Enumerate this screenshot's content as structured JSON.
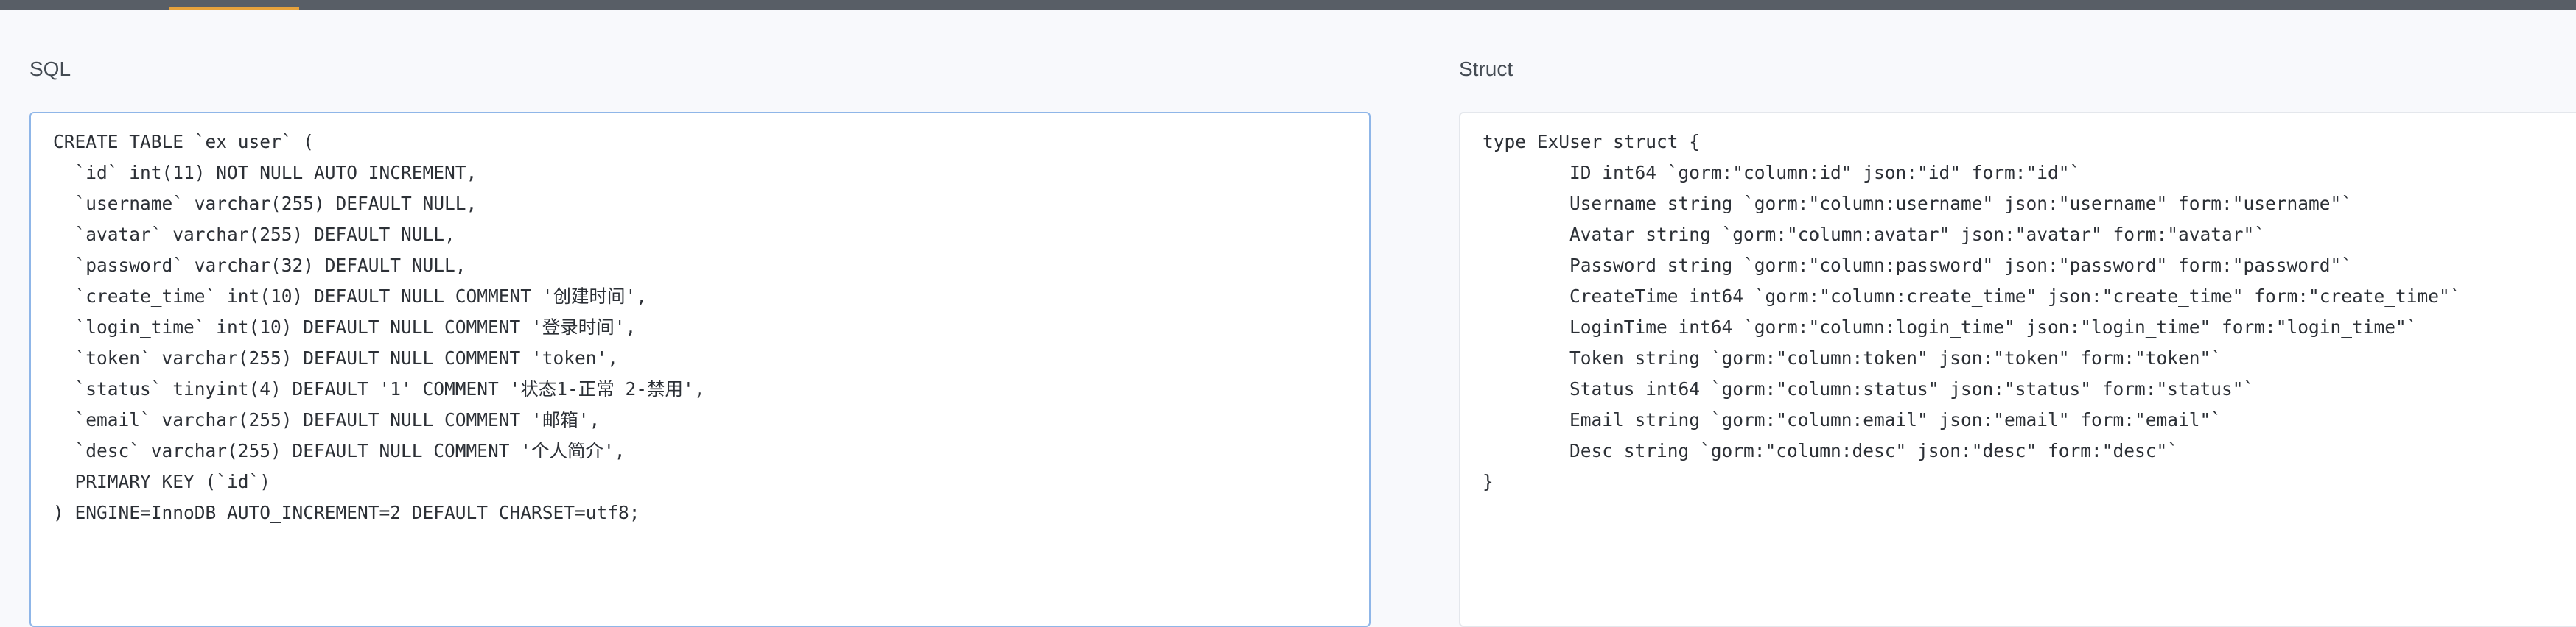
{
  "sql_panel": {
    "label": "SQL",
    "lines": [
      "CREATE TABLE `ex_user` (",
      "  `id` int(11) NOT NULL AUTO_INCREMENT,",
      "  `username` varchar(255) DEFAULT NULL,",
      "  `avatar` varchar(255) DEFAULT NULL,",
      "  `password` varchar(32) DEFAULT NULL,",
      "  `create_time` int(10) DEFAULT NULL COMMENT '创建时间',",
      "  `login_time` int(10) DEFAULT NULL COMMENT '登录时间',",
      "  `token` varchar(255) DEFAULT NULL COMMENT 'token',",
      "  `status` tinyint(4) DEFAULT '1' COMMENT '状态1-正常 2-禁用',",
      "  `email` varchar(255) DEFAULT NULL COMMENT '邮箱',",
      "  `desc` varchar(255) DEFAULT NULL COMMENT '个人简介',",
      "  PRIMARY KEY (`id`)",
      ") ENGINE=InnoDB AUTO_INCREMENT=2 DEFAULT CHARSET=utf8;"
    ]
  },
  "struct_panel": {
    "label": "Struct",
    "lines": [
      "type ExUser struct {",
      "\tID int64 `gorm:\"column:id\" json:\"id\" form:\"id\"`",
      "\tUsername string `gorm:\"column:username\" json:\"username\" form:\"username\"`",
      "\tAvatar string `gorm:\"column:avatar\" json:\"avatar\" form:\"avatar\"`",
      "\tPassword string `gorm:\"column:password\" json:\"password\" form:\"password\"`",
      "\tCreateTime int64 `gorm:\"column:create_time\" json:\"create_time\" form:\"create_time\"`",
      "\tLoginTime int64 `gorm:\"column:login_time\" json:\"login_time\" form:\"login_time\"`",
      "\tToken string `gorm:\"column:token\" json:\"token\" form:\"token\"`",
      "\tStatus int64 `gorm:\"column:status\" json:\"status\" form:\"status\"`",
      "\tEmail string `gorm:\"column:email\" json:\"email\" form:\"email\"`",
      "\tDesc string `gorm:\"column:desc\" json:\"desc\" form:\"desc\"`",
      "}"
    ]
  }
}
